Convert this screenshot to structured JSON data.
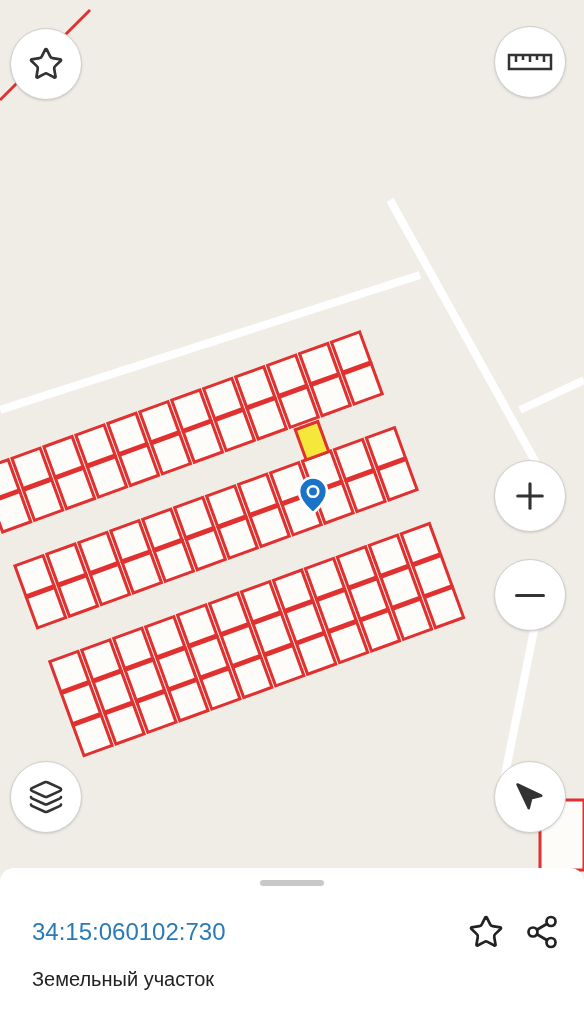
{
  "parcel": {
    "cadastral_number": "34:15:060102:730",
    "type": "Земельный участок"
  }
}
